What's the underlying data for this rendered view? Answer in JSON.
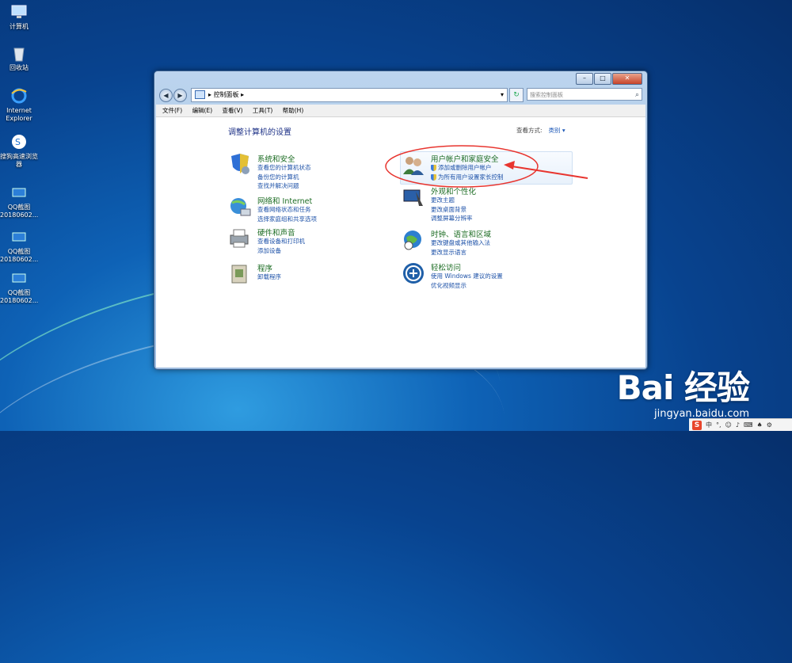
{
  "desktop": {
    "icons": [
      {
        "label": "计算机",
        "icon": "computer-icon"
      },
      {
        "label": "回收站",
        "icon": "recycle-bin-icon"
      },
      {
        "label": "Internet Explorer",
        "icon": "ie-icon"
      },
      {
        "label": "搜狗高速浏览器",
        "icon": "sogou-browser-icon"
      },
      {
        "label": "QQ截图20180602...",
        "icon": "screenshot-file-icon"
      },
      {
        "label": "QQ截图20180602...",
        "icon": "screenshot-file-icon"
      },
      {
        "label": "QQ截图20180602...",
        "icon": "screenshot-file-icon"
      }
    ]
  },
  "window": {
    "breadcrumb": "控制面板",
    "search_placeholder": "搜索控制面板",
    "menu": [
      "文件(F)",
      "编辑(E)",
      "查看(V)",
      "工具(T)",
      "帮助(H)"
    ],
    "page_title": "调整计算机的设置",
    "view_by_label": "查看方式:",
    "view_by_value": "类别 ▾",
    "categories": [
      {
        "title": "系统和安全",
        "icon": "security-shield-icon",
        "links": [
          "查看您的计算机状态",
          "备份您的计算机",
          "查找并解决问题"
        ]
      },
      {
        "title": "网络和 Internet",
        "icon": "network-globe-icon",
        "links": [
          "查看网络状态和任务",
          "选择家庭组和共享选项"
        ]
      },
      {
        "title": "硬件和声音",
        "icon": "printer-icon",
        "links": [
          "查看设备和打印机",
          "添加设备"
        ]
      },
      {
        "title": "程序",
        "icon": "programs-icon",
        "links": [
          "卸载程序"
        ]
      },
      {
        "title": "用户帐户和家庭安全",
        "icon": "users-icon",
        "links": [
          "添加或删除用户帐户",
          "为所有用户设置家长控制"
        ]
      },
      {
        "title": "外观和个性化",
        "icon": "appearance-icon",
        "links": [
          "更改主题",
          "更改桌面背景",
          "调整屏幕分辨率"
        ]
      },
      {
        "title": "时钟、语言和区域",
        "icon": "clock-globe-icon",
        "links": [
          "更改键盘或其他输入法",
          "更改显示语言"
        ]
      },
      {
        "title": "轻松访问",
        "icon": "ease-of-access-icon",
        "links": [
          "使用 Windows 建议的设置",
          "优化视频显示"
        ]
      }
    ]
  },
  "watermark": {
    "logo": "Bai 经验",
    "url": "jingyan.baidu.com"
  },
  "tray": {
    "ime": "S",
    "label": "中"
  },
  "colors": {
    "annotation": "#e8352f",
    "link": "#1e52a8",
    "category_title": "#1c6c23"
  }
}
